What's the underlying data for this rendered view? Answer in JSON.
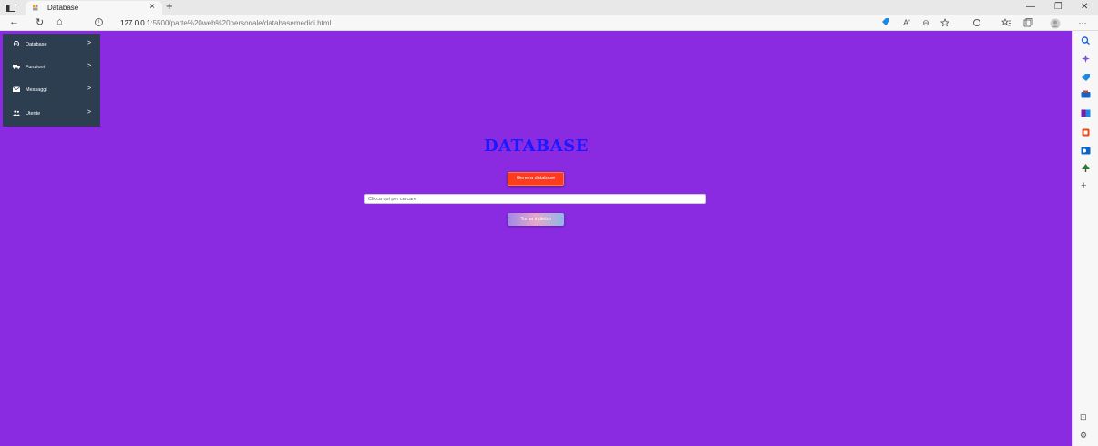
{
  "browser": {
    "tab_title": "Database",
    "tab_close": "×",
    "new_tab": "+",
    "url_host": "127.0.0.1",
    "url_path": ":5500/parte%20web%20personale/databasemedici.html",
    "info_glyph": "i",
    "back_glyph": "←",
    "reload_glyph": "↻",
    "home_glyph": "⌂",
    "minimize_glyph": "—",
    "restore_glyph": "❐",
    "close_glyph": "✕",
    "toolbar_icons": [
      "tag-icon",
      "read-aloud-icon",
      "zoom-icon",
      "favorite-icon",
      "extensions-icon",
      "favorites-icon",
      "collections-icon",
      "profile-icon",
      "more-icon"
    ],
    "more_glyph": "···",
    "read_aloud_glyph": "Aʹ",
    "zoom_glyph": "⊖",
    "edge_icons": [
      "search-icon",
      "copilot-icon",
      "shopping-icon",
      "tools-icon",
      "games-icon",
      "office-icon",
      "outlook-icon",
      "tree-icon"
    ],
    "edge_add_glyph": "+",
    "edge_bottom_glyphs": [
      "⊡",
      "⚙"
    ]
  },
  "colors": {
    "page_bg": "#8a2be2",
    "sidebar_bg": "#2c3e50",
    "title": "#1a1aff",
    "generate_button": "#ff3b1f"
  },
  "sidebar": {
    "items": [
      {
        "label": "Database",
        "icon": "database-icon",
        "arrow": ">"
      },
      {
        "label": "Funzioni",
        "icon": "truck-icon",
        "arrow": ">"
      },
      {
        "label": "Messaggi",
        "icon": "envelope-icon",
        "arrow": ">"
      },
      {
        "label": "Utente",
        "icon": "users-icon",
        "arrow": ">"
      }
    ]
  },
  "main": {
    "title": "DATABASE",
    "generate_label": "Genera database",
    "search_placeholder": "Clicca qui per cercare",
    "back_label": "Torna indietro"
  }
}
